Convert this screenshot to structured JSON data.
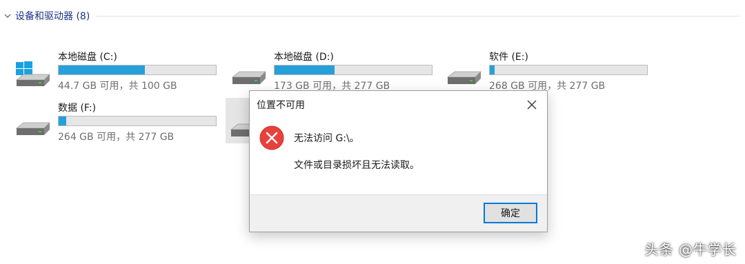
{
  "group": {
    "label": "设备和驱动器 (8)",
    "chevron_icon": "chevron-down-icon"
  },
  "drives": [
    {
      "name": "本地磁盘 (C:)",
      "size_text": "44.7 GB 可用，共 100 GB",
      "used_fraction": 0.55,
      "icon": "windows-drive-icon",
      "bar_color": "#26a0da"
    },
    {
      "name": "本地磁盘 (D:)",
      "size_text": "173 GB 可用，共 277 GB",
      "used_fraction": 0.38,
      "icon": "drive-icon",
      "bar_color": "#26a0da"
    },
    {
      "name": "软件 (E:)",
      "size_text": "268 GB 可用，共 277 GB",
      "used_fraction": 0.03,
      "icon": "drive-icon",
      "bar_color": "#26a0da"
    },
    {
      "name": "数据 (F:)",
      "size_text": "264 GB 可用，共 277 GB",
      "used_fraction": 0.05,
      "icon": "drive-icon",
      "bar_color": "#26a0da"
    },
    {
      "name": "",
      "size_text": "",
      "used_fraction": 0,
      "icon": "drive-icon",
      "selected": true
    }
  ],
  "dialog": {
    "title": "位置不可用",
    "close_icon": "close-icon",
    "error_icon": "error-icon",
    "message_line1": "无法访问 G:\\。",
    "message_line2": "文件或目录损坏且无法读取。",
    "ok_label": "确定"
  },
  "watermark": "头条 @牛学长",
  "colors": {
    "accent": "#0078d7",
    "bar_fill": "#26a0da",
    "error_red": "#e8413b",
    "group_text": "#1e3287"
  }
}
